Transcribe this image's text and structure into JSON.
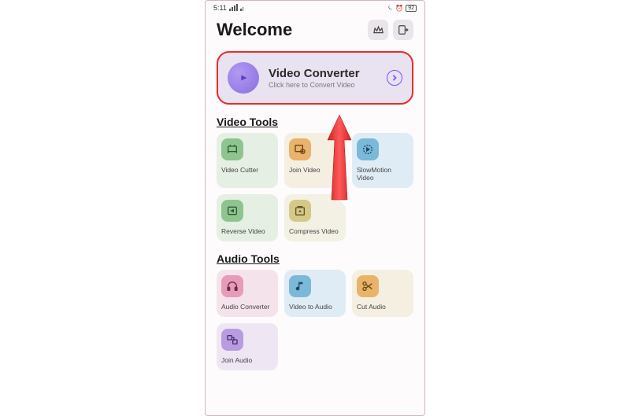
{
  "status": {
    "time": "5:11",
    "signal_text": "⁴ᴳ ₊₊₊",
    "right_indicators": "⏾ ⏰ 🔲92"
  },
  "header": {
    "title": "Welcome"
  },
  "main_card": {
    "title": "Video Converter",
    "subtitle": "Click here to Convert Video"
  },
  "sections": {
    "video_tools": "Video Tools",
    "audio_tools": "Audio Tools"
  },
  "video_tools": [
    {
      "label": "Video Cutter"
    },
    {
      "label": "Join Video"
    },
    {
      "label": "SlowMotion Video"
    },
    {
      "label": "Reverse Video"
    },
    {
      "label": "Compress Video",
      "hot": true
    }
  ],
  "audio_tools": [
    {
      "label": "Audio Converter"
    },
    {
      "label": "Video to Audio"
    },
    {
      "label": "Cut Audio"
    },
    {
      "label": "Join Audio"
    }
  ]
}
